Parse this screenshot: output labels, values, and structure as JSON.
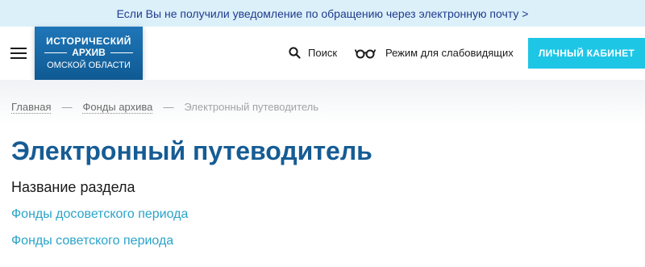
{
  "notice": {
    "text": "Если Вы не получили уведомление по обращению через электронную почту >"
  },
  "header": {
    "logo": {
      "line1": "ИСТОРИЧЕСКИЙ",
      "line2": "АРХИВ",
      "line3": "ОМСКОЙ ОБЛАСТИ"
    },
    "search_label": "Поиск",
    "vision_label": "Режим для слабовидящих",
    "cabinet_label": "ЛИЧНЫЙ КАБИНЕТ",
    "icons": [
      "menu-icon",
      "search-icon",
      "glasses-icon"
    ]
  },
  "breadcrumb": {
    "items": [
      "Главная",
      "Фонды архива"
    ],
    "separator": "—",
    "current": "Электронный путеводитель"
  },
  "page": {
    "title": "Электронный путеводитель",
    "section_title": "Название раздела",
    "links": [
      "Фонды досоветского периода",
      "Фонды советского периода"
    ]
  },
  "colors": {
    "notice_bg": "#dcf0fa",
    "brand_blue": "#165c94",
    "cabinet_button": "#1ec6e6",
    "link": "#2aa3c9"
  }
}
